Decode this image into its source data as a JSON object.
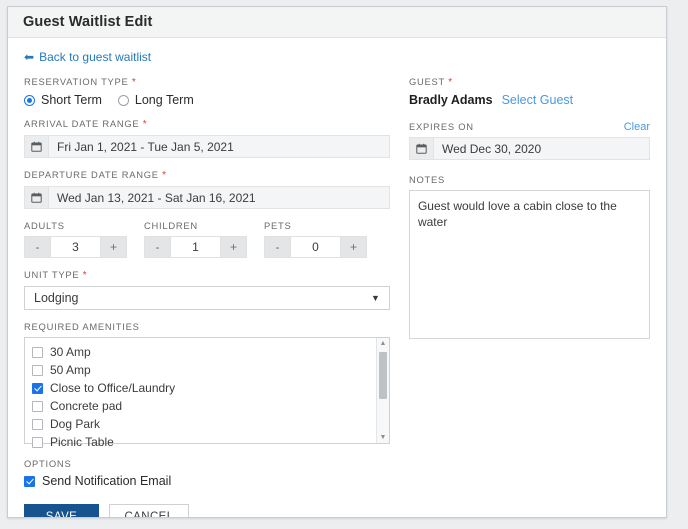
{
  "header": {
    "title": "Guest Waitlist Edit"
  },
  "back_link": {
    "label": "Back to guest waitlist",
    "icon": "arrow-left-icon"
  },
  "reservation_type": {
    "label": "RESERVATION TYPE",
    "required": "*",
    "options": [
      {
        "label": "Short Term",
        "selected": true
      },
      {
        "label": "Long Term",
        "selected": false
      }
    ]
  },
  "arrival_date_range": {
    "label": "ARRIVAL DATE RANGE",
    "required": "*",
    "icon": "calendar-icon",
    "value": "Fri Jan 1, 2021 - Tue Jan 5, 2021"
  },
  "departure_date_range": {
    "label": "DEPARTURE DATE RANGE",
    "required": "*",
    "icon": "calendar-icon",
    "value": "Wed Jan 13, 2021 - Sat Jan 16, 2021"
  },
  "counters": [
    {
      "label": "ADULTS",
      "value": "3",
      "minus": "-",
      "plus": "+"
    },
    {
      "label": "CHILDREN",
      "value": "1",
      "minus": "-",
      "plus": "+"
    },
    {
      "label": "PETS",
      "value": "0",
      "minus": "-",
      "plus": "+"
    }
  ],
  "unit_type": {
    "label": "UNIT TYPE",
    "required": "*",
    "value": "Lodging",
    "chevron": "chevron-down-icon"
  },
  "required_amenities": {
    "label": "REQUIRED AMENITIES",
    "items": [
      {
        "label": "30 Amp",
        "checked": false
      },
      {
        "label": "50 Amp",
        "checked": false
      },
      {
        "label": "Close to Office/Laundry",
        "checked": true
      },
      {
        "label": "Concrete pad",
        "checked": false
      },
      {
        "label": "Dog Park",
        "checked": false
      },
      {
        "label": "Picnic Table",
        "checked": false
      }
    ],
    "scroll_up": "▲",
    "scroll_down": "▼"
  },
  "options": {
    "label": "OPTIONS",
    "items": [
      {
        "label": "Send Notification Email",
        "checked": true
      }
    ]
  },
  "buttons": {
    "save_label": "SAVE",
    "cancel_label": "CANCEL"
  },
  "guest": {
    "label": "GUEST",
    "required": "*",
    "name": "Bradly Adams",
    "select_link": "Select Guest"
  },
  "expires_on": {
    "label": "EXPIRES ON",
    "clear_label": "Clear",
    "icon": "calendar-icon",
    "value": "Wed Dec 30, 2020"
  },
  "notes": {
    "label": "NOTES",
    "value": "Guest would love a cabin close to the water"
  },
  "colors": {
    "accent_blue": "#1a73e8",
    "link_blue": "#2779bd",
    "save_blue": "#17548f",
    "required_red": "#d0452c"
  }
}
